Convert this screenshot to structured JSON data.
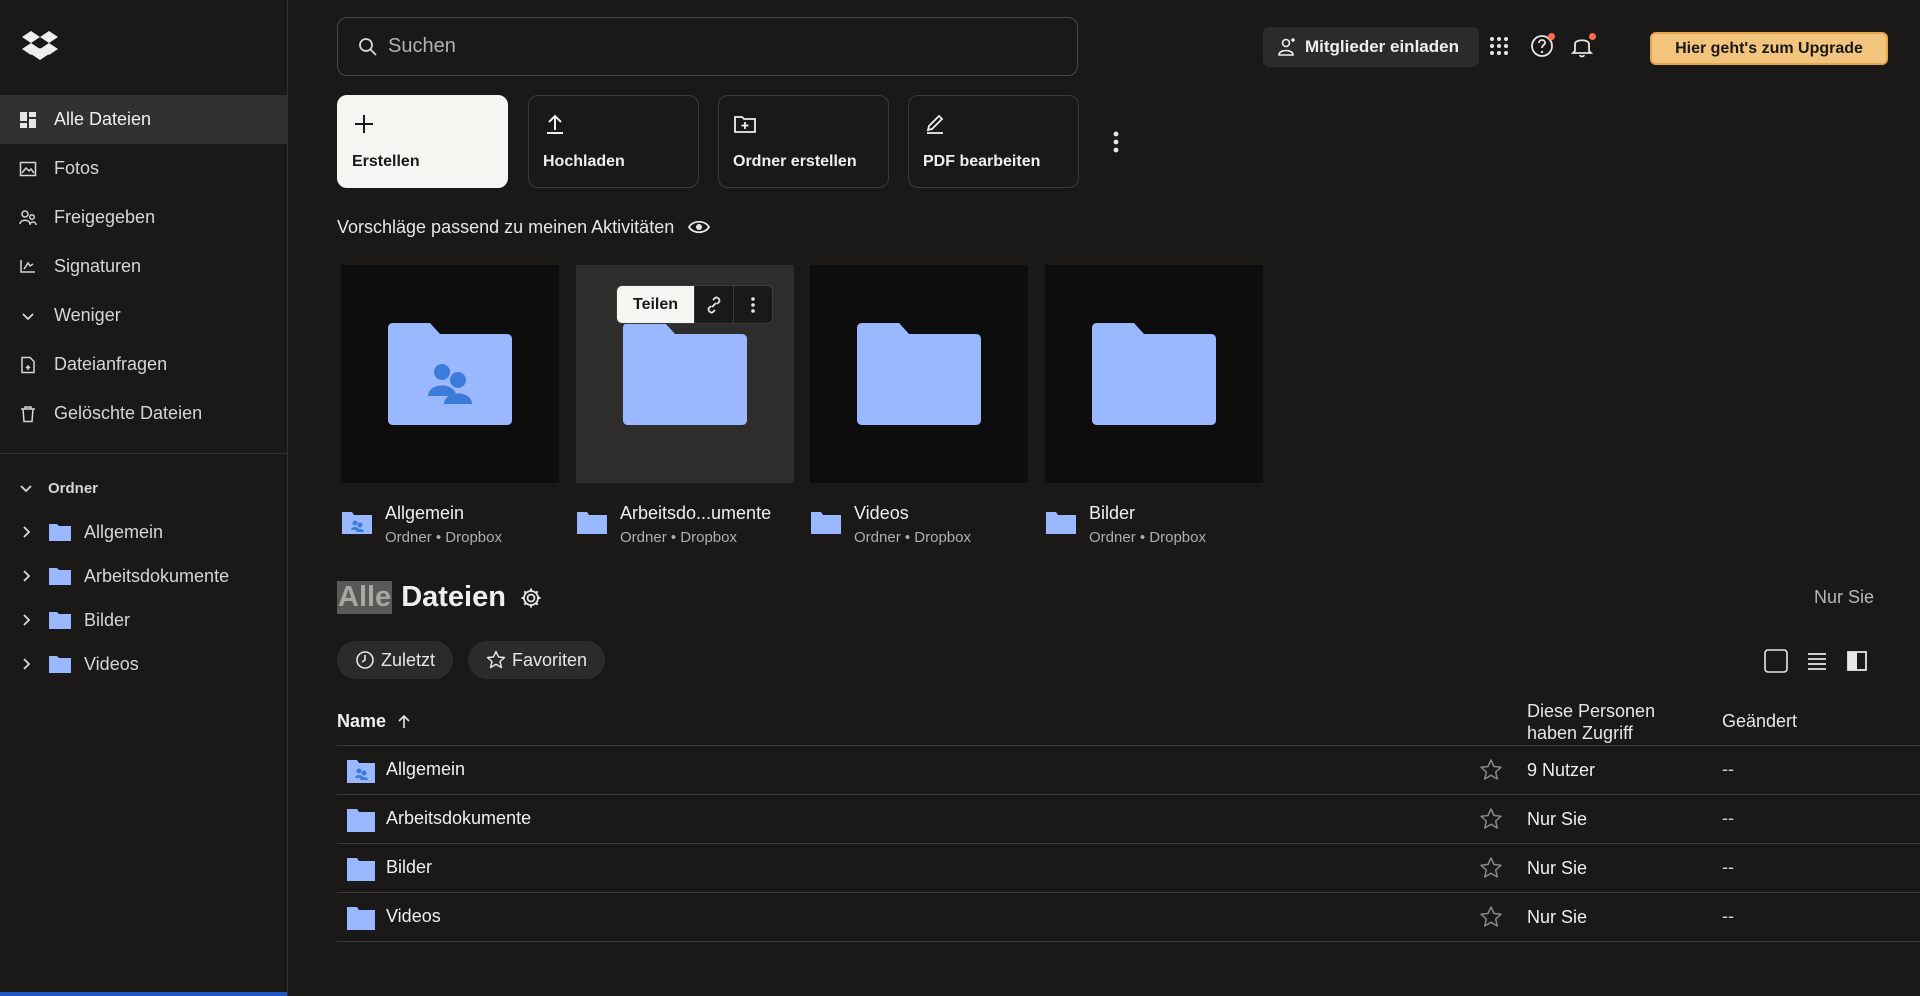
{
  "colors": {
    "folder": "#9ab8ff",
    "folder_person": "#3d7bdb",
    "accent_upgrade": "#f3c47e",
    "notification_dot": "#ff6a4d"
  },
  "sidebar": {
    "nav": [
      {
        "label": "Alle Dateien",
        "icon": "all-files-icon",
        "active": true
      },
      {
        "label": "Fotos",
        "icon": "photos-icon"
      },
      {
        "label": "Freigegeben",
        "icon": "shared-icon"
      },
      {
        "label": "Signaturen",
        "icon": "signature-icon"
      },
      {
        "label": "Weniger",
        "icon": "chevron-down-icon"
      },
      {
        "label": "Dateianfragen",
        "icon": "file-request-icon"
      },
      {
        "label": "Gelöschte Dateien",
        "icon": "trash-icon"
      }
    ],
    "ordner_label": "Ordner",
    "folders": [
      "Allgemein",
      "Arbeitsdokumente",
      "Bilder",
      "Videos"
    ]
  },
  "header": {
    "search_placeholder": "Suchen",
    "invite_label": "Mitglieder einladen",
    "upgrade_label": "Hier geht's zum Upgrade"
  },
  "actions": [
    {
      "label": "Erstellen",
      "icon": "plus-icon"
    },
    {
      "label": "Hochladen",
      "icon": "upload-icon"
    },
    {
      "label": "Ordner erstellen",
      "icon": "create-folder-icon"
    },
    {
      "label": "PDF bearbeiten",
      "icon": "edit-pdf-icon"
    }
  ],
  "suggestions": {
    "title": "Vorschläge passend zu meinen Aktivitäten",
    "share_label": "Teilen",
    "items": [
      {
        "name": "Allgemein",
        "sub": "Ordner • Dropbox",
        "shared": true
      },
      {
        "name": "Arbeitsdo...umente",
        "sub": "Ordner • Dropbox"
      },
      {
        "name": "Videos",
        "sub": "Ordner • Dropbox"
      },
      {
        "name": "Bilder",
        "sub": "Ordner • Dropbox"
      }
    ]
  },
  "files": {
    "title_highlight": "Alle",
    "title_rest": "Dateien",
    "visibility": "Nur Sie",
    "chips": [
      "Zuletzt",
      "Favoriten"
    ],
    "columns": {
      "name": "Name",
      "access_line1": "Diese Personen",
      "access_line2": "haben Zugriff",
      "changed": "Geändert"
    },
    "rows": [
      {
        "name": "Allgemein",
        "access": "9 Nutzer",
        "changed": "--",
        "shared": true
      },
      {
        "name": "Arbeitsdokumente",
        "access": "Nur Sie",
        "changed": "--"
      },
      {
        "name": "Bilder",
        "access": "Nur Sie",
        "changed": "--"
      },
      {
        "name": "Videos",
        "access": "Nur Sie",
        "changed": "--"
      }
    ]
  }
}
